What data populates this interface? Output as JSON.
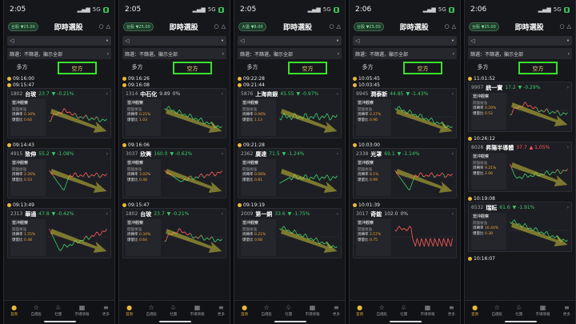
{
  "common": {
    "app_title": "即時選股",
    "filter_text": "篩選：不篩選，顯示全部",
    "tab_long": "多方",
    "tab_short": "空方",
    "card_header": "當沖觀察",
    "stat_sub": "開盤後強",
    "stat_label_1": "周轉率",
    "stat_label_2": "爆量比",
    "nav": [
      "首頁",
      "自選股",
      "社團",
      "市場情報",
      "更多"
    ],
    "up_color": "#ff5a5a",
    "down_color": "#3dc96a",
    "arrow_color": "#c9c23b"
  },
  "phones": [
    {
      "time": "2:05",
      "index": "台股 ▼25.00",
      "signals": [
        {
          "ts": [
            "09:16:00",
            "09:15:47"
          ],
          "code": "1802",
          "name": "台玻",
          "price": "23.7",
          "chg": "▼ -0.21%",
          "pc": "g",
          "s1": "0.34%",
          "s2": "0.64",
          "shape": "hump"
        },
        {
          "ts": [
            "09:14:43"
          ],
          "code": "4915",
          "name": "致伸",
          "price": "55.2",
          "chg": "▼ -1.08%",
          "pc": "g",
          "s1": "2.26%",
          "s2": "0.53",
          "shape": "vdip"
        },
        {
          "ts": [
            "09:13:49"
          ],
          "code": "2313",
          "name": "華通",
          "price": "47.8",
          "chg": "▼ -0.42%",
          "pc": "g",
          "s1": "1.55%",
          "s2": "0.48",
          "shape": "vdip2"
        }
      ]
    },
    {
      "time": "2:05",
      "index": "台股 ▼25.00",
      "signals": [
        {
          "ts": [
            "09:16:26",
            "09:16:08"
          ],
          "code": "1314",
          "name": "中石化",
          "price": "9.89",
          "chg": "0%",
          "pc": "w",
          "s1": "0.21%",
          "s2": "1.03",
          "shape": "fall"
        },
        {
          "ts": [
            "09:16:06"
          ],
          "code": "3037",
          "name": "欣興",
          "price": "160.0",
          "chg": "▼ -0.62%",
          "pc": "g",
          "s1": "3.02%",
          "s2": "0.48",
          "shape": "dip"
        },
        {
          "ts": [
            "09:15:47"
          ],
          "code": "1802",
          "name": "台玻",
          "price": "23.7",
          "chg": "▼ -0.21%",
          "pc": "g",
          "s1": "0.34%",
          "s2": "0.64",
          "shape": "hump"
        }
      ]
    },
    {
      "time": "2:05",
      "index": "大盤 ▼8.00",
      "signals": [
        {
          "ts": [
            "09:22:28",
            "09:21:44"
          ],
          "code": "5876",
          "name": "上海商銀",
          "price": "45.55",
          "chg": "▼ -0.97%",
          "pc": "g",
          "s1": "0.06%",
          "s2": "1.13",
          "shape": "flat"
        },
        {
          "ts": [
            "09:21:28"
          ],
          "code": "2362",
          "name": "廣達",
          "price": "71.5",
          "chg": "▼ -1.24%",
          "pc": "g",
          "s1": "0.08%",
          "s2": "0.81",
          "shape": "flat2"
        },
        {
          "ts": [
            "09:19:19"
          ],
          "code": "2009",
          "name": "第一銅",
          "price": "33.6",
          "chg": "▼ -1.75%",
          "pc": "g",
          "s1": "0.21%",
          "s2": "0.68",
          "shape": "fall"
        }
      ]
    },
    {
      "time": "2:06",
      "index": "台股 ▼25.00",
      "signals": [
        {
          "ts": [
            "10:05:45",
            "10:03:45"
          ],
          "code": "9945",
          "name": "潤泰新",
          "price": "44.85",
          "chg": "▼ -1.43%",
          "pc": "g",
          "s1": "0.27%",
          "s2": "0.96",
          "shape": "fall"
        },
        {
          "ts": [
            "10:03:00"
          ],
          "code": "2338",
          "name": "光罩",
          "price": "69.1",
          "chg": "▼ -1.14%",
          "pc": "g",
          "s1": "8.1%",
          "s2": "0.99",
          "shape": "vdip"
        },
        {
          "ts": [
            "10:01:39"
          ],
          "code": "3017",
          "name": "奇鋐",
          "price": "102.0",
          "chg": "0%",
          "pc": "w",
          "s1": "2.57%",
          "s2": "0.75",
          "shape": "red"
        }
      ]
    },
    {
      "time": "2:06",
      "index": "台股 ▼25.00",
      "signals": [
        {
          "ts": [
            "11:01:52"
          ],
          "code": "9907",
          "name": "統一實",
          "price": "17.2",
          "chg": "▼ -0.29%",
          "pc": "g",
          "s1": "0.29%",
          "s2": "0.52",
          "shape": "hump"
        },
        {
          "ts": [
            "10:26:12"
          ],
          "code": "8028",
          "name": "昇陽半導體",
          "price": "37.7",
          "chg": "▲ 1.05%",
          "pc": "r",
          "s1": "9.21%",
          "s2": "2.06",
          "shape": "rise"
        },
        {
          "ts": [
            "10:19:08"
          ],
          "code": "6532",
          "name": "瑞耘",
          "price": "61.6",
          "chg": "▼ -1.91%",
          "pc": "g",
          "s1": "16.44%",
          "s2": "0.38",
          "shape": "fall"
        }
      ],
      "tail_ts": "10:16:07"
    }
  ]
}
